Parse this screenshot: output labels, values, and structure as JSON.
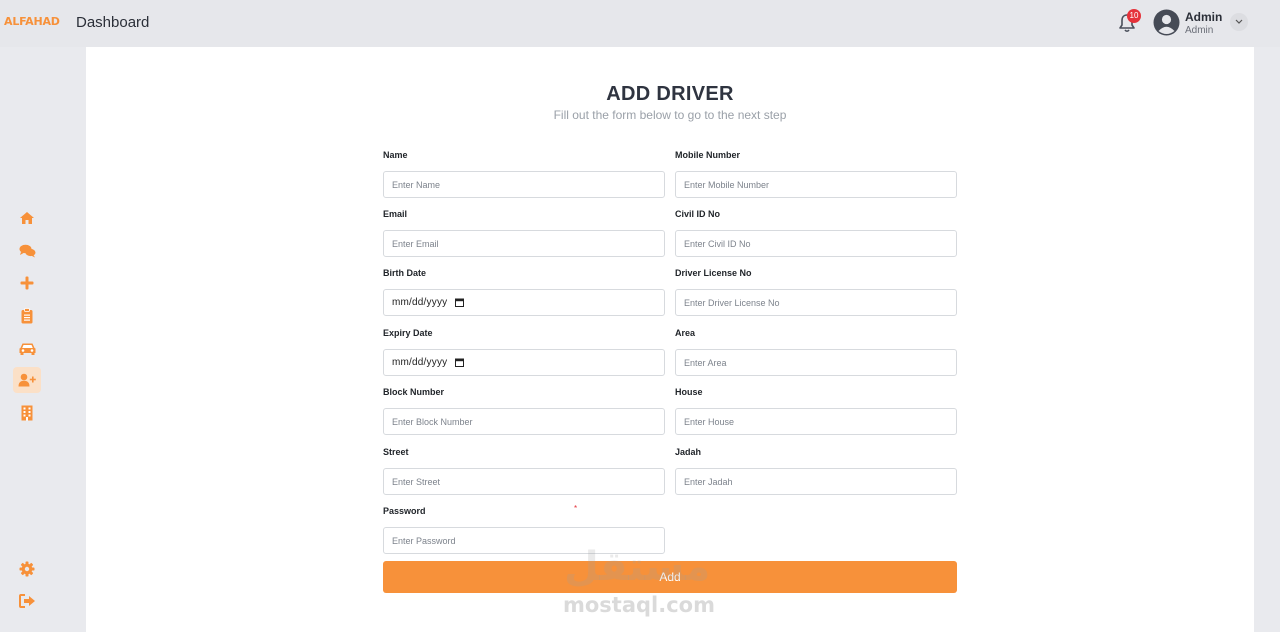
{
  "header": {
    "brand": "ALFAHAD",
    "page_title": "Dashboard",
    "notifications_count": "10",
    "user_name": "Admin",
    "user_role": "Admin"
  },
  "sidebar": {
    "items": [
      {
        "icon": "home-icon",
        "active": false
      },
      {
        "icon": "chat-icon",
        "active": false
      },
      {
        "icon": "plus-icon",
        "active": false
      },
      {
        "icon": "clipboard-icon",
        "active": false
      },
      {
        "icon": "car-icon",
        "active": false
      },
      {
        "icon": "user-plus-icon",
        "active": true
      },
      {
        "icon": "building-icon",
        "active": false
      }
    ],
    "bottom_items": [
      {
        "icon": "gear-icon"
      },
      {
        "icon": "logout-icon"
      }
    ]
  },
  "form": {
    "title": "ADD DRIVER",
    "subtitle": "Fill out the form below to go to the next step",
    "fields": {
      "name": {
        "label": "Name",
        "placeholder": "Enter Name",
        "value": ""
      },
      "mobile": {
        "label": "Mobile Number",
        "placeholder": "Enter Mobile Number",
        "value": ""
      },
      "email": {
        "label": "Email",
        "placeholder": "Enter Email",
        "value": ""
      },
      "civil_id": {
        "label": "Civil ID No",
        "placeholder": "Enter Civil ID No",
        "value": ""
      },
      "birth_date": {
        "label": "Birth Date",
        "value": "mm/dd/yyyy"
      },
      "license": {
        "label": "Driver License No",
        "placeholder": "Enter Driver License No",
        "value": ""
      },
      "expiry_date": {
        "label": "Expiry Date",
        "value": "mm/dd/yyyy"
      },
      "area": {
        "label": "Area",
        "placeholder": "Enter Area",
        "value": ""
      },
      "block": {
        "label": "Block Number",
        "placeholder": "Enter Block Number",
        "value": ""
      },
      "house": {
        "label": "House",
        "placeholder": "Enter House",
        "value": ""
      },
      "street": {
        "label": "Street",
        "placeholder": "Enter Street",
        "value": ""
      },
      "jadah": {
        "label": "Jadah",
        "placeholder": "Enter Jadah",
        "value": ""
      },
      "password": {
        "label": "Password",
        "placeholder": "Enter Password",
        "value": ""
      }
    },
    "required_marker": "*",
    "submit_label": "Add"
  },
  "watermark": {
    "arabic": "مستقل",
    "latin": "mostaql.com"
  },
  "colors": {
    "accent": "#f7913a",
    "badge": "#e5323a",
    "active_nav_bg": "#fbe0c7"
  }
}
